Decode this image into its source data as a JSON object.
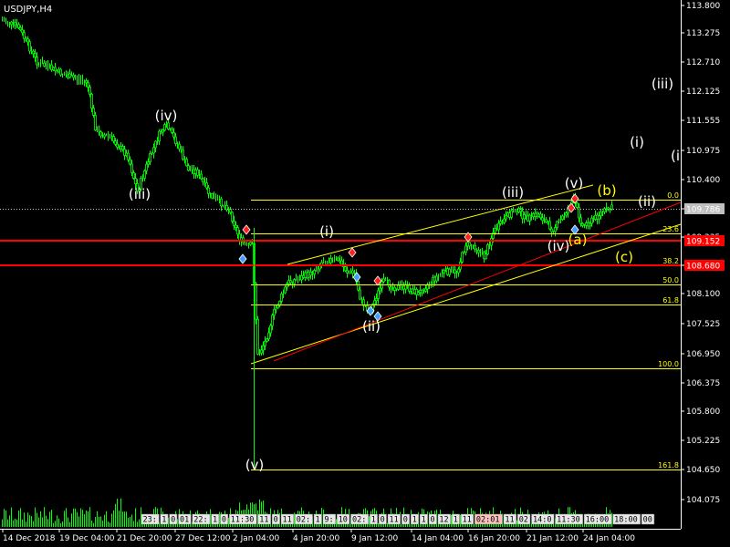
{
  "title": "USDJPY,H4",
  "colors": {
    "background": "#000000",
    "candle": "#00ff00",
    "grid": "#ffffff",
    "fib": "#ffff00",
    "channel": "#ffff00",
    "red_channel": "#ff0000",
    "hline": "#ff0000",
    "price_label_bg": "#ff0000",
    "current_price_bg": "#c0c0c0",
    "wave_white": "#ffffff",
    "wave_yellow": "#ffff00",
    "icon_red": "#ff2020",
    "icon_blue": "#40a0ff"
  },
  "price_axis": {
    "ticks": [
      "113.800",
      "113.275",
      "112.710",
      "112.125",
      "111.555",
      "110.975",
      "110.400",
      "109.815",
      "109.235",
      "108.655",
      "108.100",
      "107.525",
      "106.950",
      "106.375",
      "105.800",
      "105.225",
      "104.650",
      "104.075"
    ]
  },
  "time_axis": {
    "labels": [
      "14 Dec 2018",
      "19 Dec 04:00",
      "21 Dec 20:00",
      "27 Dec 12:00",
      "2 Jan 04:00",
      "4 Jan 20:00",
      "9 Jan 12:00",
      "14 Jan 04:00",
      "16 Jan 20:00",
      "21 Jan 12:00",
      "24 Jan 04:00"
    ]
  },
  "price_labels": [
    {
      "text": "109.786",
      "style": "current"
    },
    {
      "text": "109.152",
      "style": "red"
    },
    {
      "text": "108.680",
      "style": "red"
    }
  ],
  "fib_labels": [
    "0.0",
    "23.6",
    "38.2",
    "50.0",
    "61.8",
    "100.0",
    "161.8"
  ],
  "wave_labels": [
    {
      "text": "(iii)",
      "color": "white"
    },
    {
      "text": "(iv)",
      "color": "white"
    },
    {
      "text": "(v)",
      "color": "white"
    },
    {
      "text": "(i)",
      "color": "white"
    },
    {
      "text": "(ii)",
      "color": "white"
    },
    {
      "text": "(iii)",
      "color": "white"
    },
    {
      "text": "(iv)",
      "color": "white"
    },
    {
      "text": "(v)",
      "color": "white"
    },
    {
      "text": "(a)",
      "color": "yellow"
    },
    {
      "text": "(b)",
      "color": "yellow"
    },
    {
      "text": "(c)",
      "color": "yellow"
    },
    {
      "text": "(ii)",
      "color": "white"
    },
    {
      "text": "(i)",
      "color": "white"
    },
    {
      "text": "(iii)",
      "color": "white"
    },
    {
      "text": "(i",
      "color": "white"
    }
  ],
  "session_labels": [
    "23:",
    "1",
    "0",
    "01",
    "22:",
    "1",
    "0",
    "11:30",
    "11",
    "0",
    "11",
    "02:",
    "1",
    "9:",
    "10",
    "02:",
    "1",
    "0",
    "11",
    "0",
    "1",
    "1",
    "0",
    "12",
    "1",
    "11",
    "02:01",
    "11",
    "02",
    "14:0",
    "11:30",
    "16:00",
    "18:00",
    "00"
  ]
}
